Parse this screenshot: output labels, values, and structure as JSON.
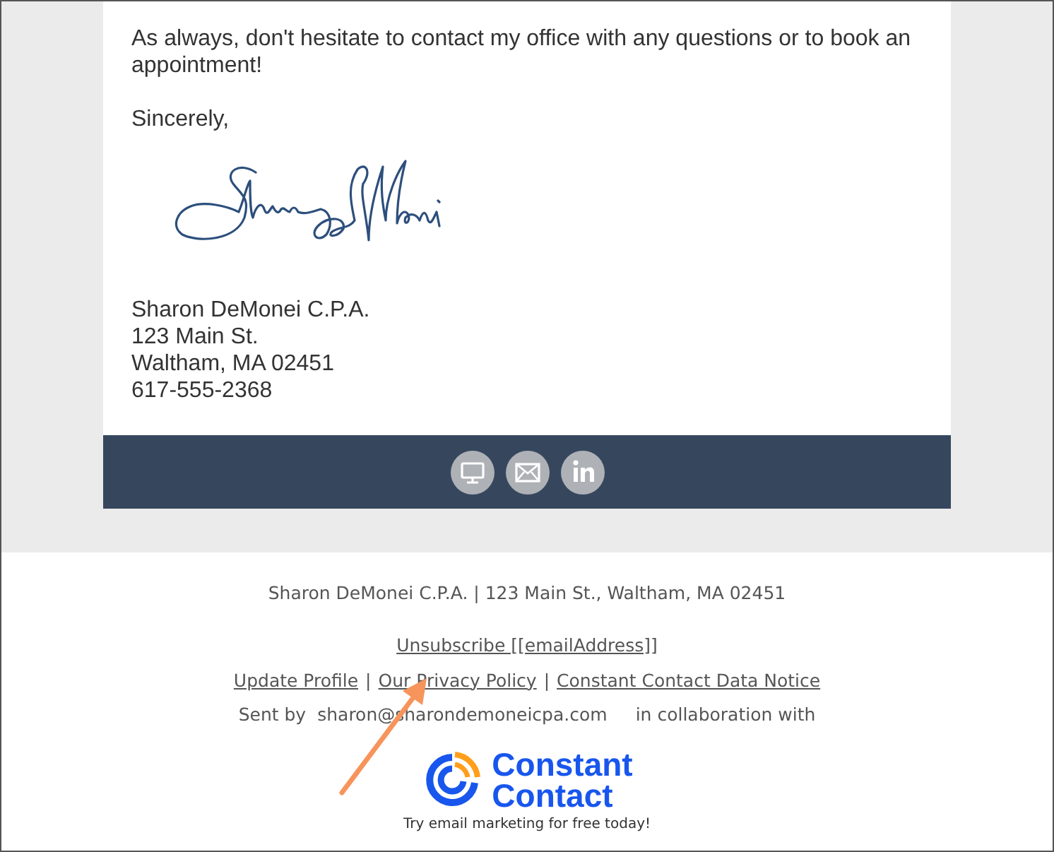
{
  "message": {
    "paragraphs": [
      "As always, don't hesitate to contact my office with any questions or to book an appointment!",
      "Sincerely,"
    ],
    "address_lines": [
      "Sharon DeMonei C.P.A.",
      "123 Main St.",
      "Waltham, MA 02451",
      "617-555-2368"
    ]
  },
  "social_icons": [
    {
      "kind": "website"
    },
    {
      "kind": "email"
    },
    {
      "kind": "linkedin"
    }
  ],
  "footer": {
    "address": "Sharon DeMonei C.P.A. | 123 Main St., Waltham, MA 02451",
    "unsubscribe": "Unsubscribe [[emailAddress]]",
    "links": [
      "Update Profile",
      "Our Privacy Policy",
      "Constant Contact Data Notice"
    ],
    "separator": "|",
    "sent_by": "Sent by",
    "sender": "sharon@sharondemoneicpa.com",
    "collaboration": "in collaboration with",
    "logo": {
      "line_1": "Constant",
      "line_2": "Contact"
    },
    "tagline": "Try email marketing for free today!"
  }
}
